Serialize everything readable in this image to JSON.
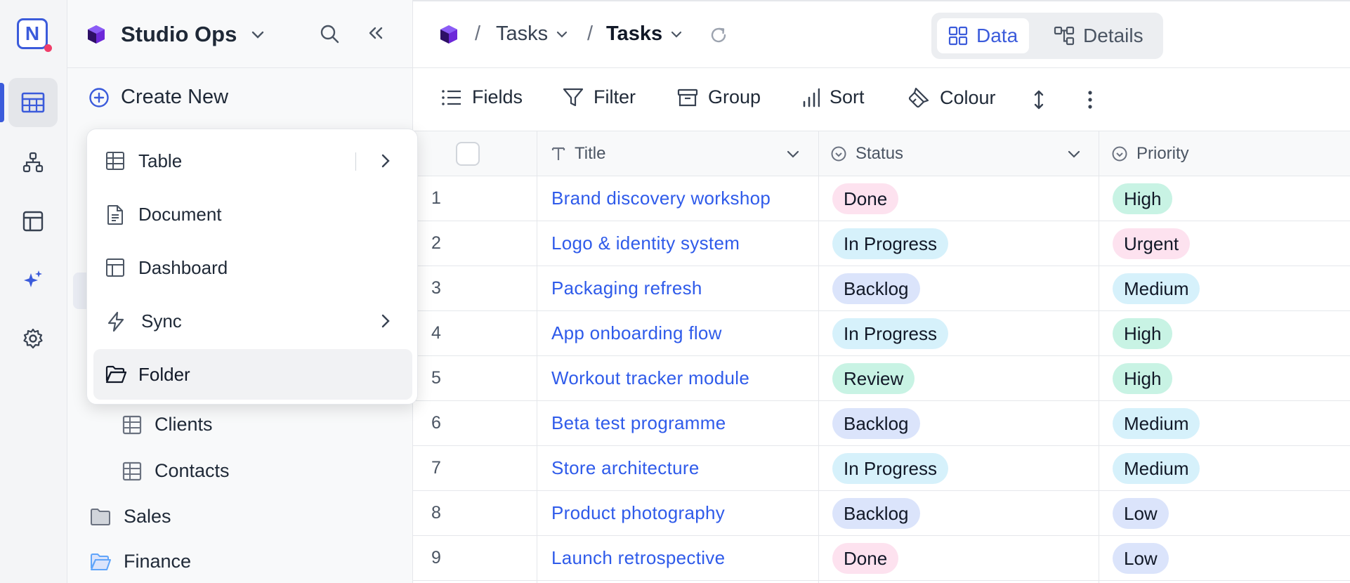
{
  "rail": {
    "logo_letter": "N",
    "items": [
      {
        "icon": "table-grid-icon",
        "active": true
      },
      {
        "icon": "hierarchy-icon",
        "active": false
      },
      {
        "icon": "dashboard-layout-icon",
        "active": false
      },
      {
        "icon": "sparkles-icon",
        "active": false
      },
      {
        "icon": "gear-icon",
        "active": false
      }
    ]
  },
  "sidebar": {
    "workspace_name": "Studio Ops",
    "create_new_label": "Create New",
    "items": [
      {
        "label": "Clients",
        "icon": "table-icon"
      },
      {
        "label": "Contacts",
        "icon": "table-icon"
      },
      {
        "label": "Sales",
        "icon": "folder-icon"
      },
      {
        "label": "Finance",
        "icon": "folder-open-icon"
      }
    ]
  },
  "create_menu": {
    "items": [
      {
        "label": "Table",
        "icon": "table-icon",
        "has_submenu": true
      },
      {
        "label": "Document",
        "icon": "document-icon",
        "has_submenu": false
      },
      {
        "label": "Dashboard",
        "icon": "dashboard-icon",
        "has_submenu": false
      },
      {
        "label": "Sync",
        "icon": "lightning-icon",
        "has_submenu": true
      },
      {
        "label": "Folder",
        "icon": "folder-open-icon",
        "has_submenu": false,
        "highlighted": true
      }
    ]
  },
  "breadcrumb": {
    "sep": "/",
    "items": [
      "Tasks",
      "Tasks"
    ]
  },
  "view_toggle": {
    "data_label": "Data",
    "details_label": "Details"
  },
  "toolbar": {
    "fields_label": "Fields",
    "filter_label": "Filter",
    "group_label": "Group",
    "sort_label": "Sort",
    "colour_label": "Colour"
  },
  "grid": {
    "columns": [
      "Title",
      "Status",
      "Priority"
    ],
    "rows": [
      {
        "n": "1",
        "title": "Brand discovery workshop",
        "status": "Done",
        "priority": "High"
      },
      {
        "n": "2",
        "title": "Logo & identity system",
        "status": "In Progress",
        "priority": "Urgent"
      },
      {
        "n": "3",
        "title": "Packaging refresh",
        "status": "Backlog",
        "priority": "Medium"
      },
      {
        "n": "4",
        "title": "App onboarding flow",
        "status": "In Progress",
        "priority": "High"
      },
      {
        "n": "5",
        "title": "Workout tracker module",
        "status": "Review",
        "priority": "High"
      },
      {
        "n": "6",
        "title": "Beta test programme",
        "status": "Backlog",
        "priority": "Medium"
      },
      {
        "n": "7",
        "title": "Store architecture",
        "status": "In Progress",
        "priority": "Medium"
      },
      {
        "n": "8",
        "title": "Product photography",
        "status": "Backlog",
        "priority": "Low"
      },
      {
        "n": "9",
        "title": "Launch retrospective",
        "status": "Done",
        "priority": "Low"
      }
    ]
  },
  "colors": {
    "accent": "#3b5bdb",
    "link": "#2f5bea",
    "status": {
      "Done": "#fde2ef",
      "In Progress": "#d6f1fb",
      "Backlog": "#dbe4fb",
      "Review": "#c8f3e4"
    },
    "priority": {
      "High": "#c8f3e4",
      "Urgent": "#fde2ef",
      "Medium": "#d6f1fb",
      "Low": "#dbe4fb"
    }
  }
}
